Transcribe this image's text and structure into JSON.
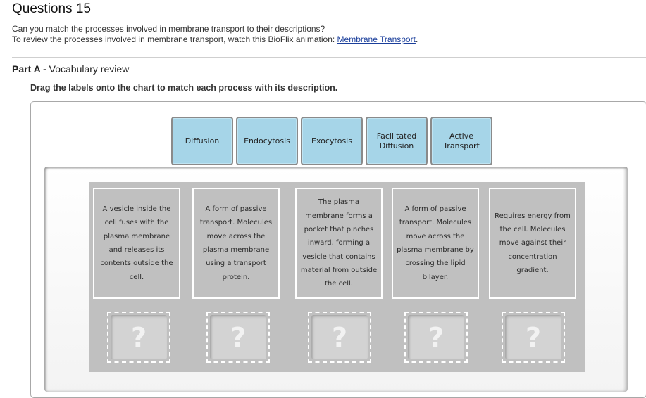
{
  "header": {
    "title": "Questions 15",
    "intro_line1": "Can you match the processes involved in membrane transport to their descriptions?",
    "intro_line2_prefix": "To review the processes involved in membrane transport, watch this BioFlix animation: ",
    "intro_link": "Membrane Transport",
    "intro_line2_suffix": "."
  },
  "part": {
    "label": "Part A -",
    "title": " Vocabulary review",
    "instructions": "Drag the labels onto the chart to match each process with its description."
  },
  "labels": [
    {
      "line1": "Diffusion",
      "line2": ""
    },
    {
      "line1": "Endocytosis",
      "line2": ""
    },
    {
      "line1": "Exocytosis",
      "line2": ""
    },
    {
      "line1": "Facilitated",
      "line2": "Diffusion"
    },
    {
      "line1": "Active",
      "line2": "Transport"
    }
  ],
  "descriptions": [
    "A vesicle inside the cell fuses with the plasma membrane and releases its contents outside the cell.",
    "A form of passive transport. Molecules move across the plasma membrane using a transport protein.",
    "The plasma membrane forms a pocket that pinches inward, forming a vesicle that contains material from outside the cell.",
    "A form of passive transport. Molecules move across the plasma membrane by crossing the lipid bilayer.",
    "Requires energy from the cell. Molecules move against their concentration gradient."
  ],
  "drop_targets": [
    "?",
    "?",
    "?",
    "?",
    "?"
  ],
  "colors": {
    "label_bg": "#a6d5e8",
    "board_bg": "#c0c0c0",
    "link": "#1a3e9b"
  }
}
